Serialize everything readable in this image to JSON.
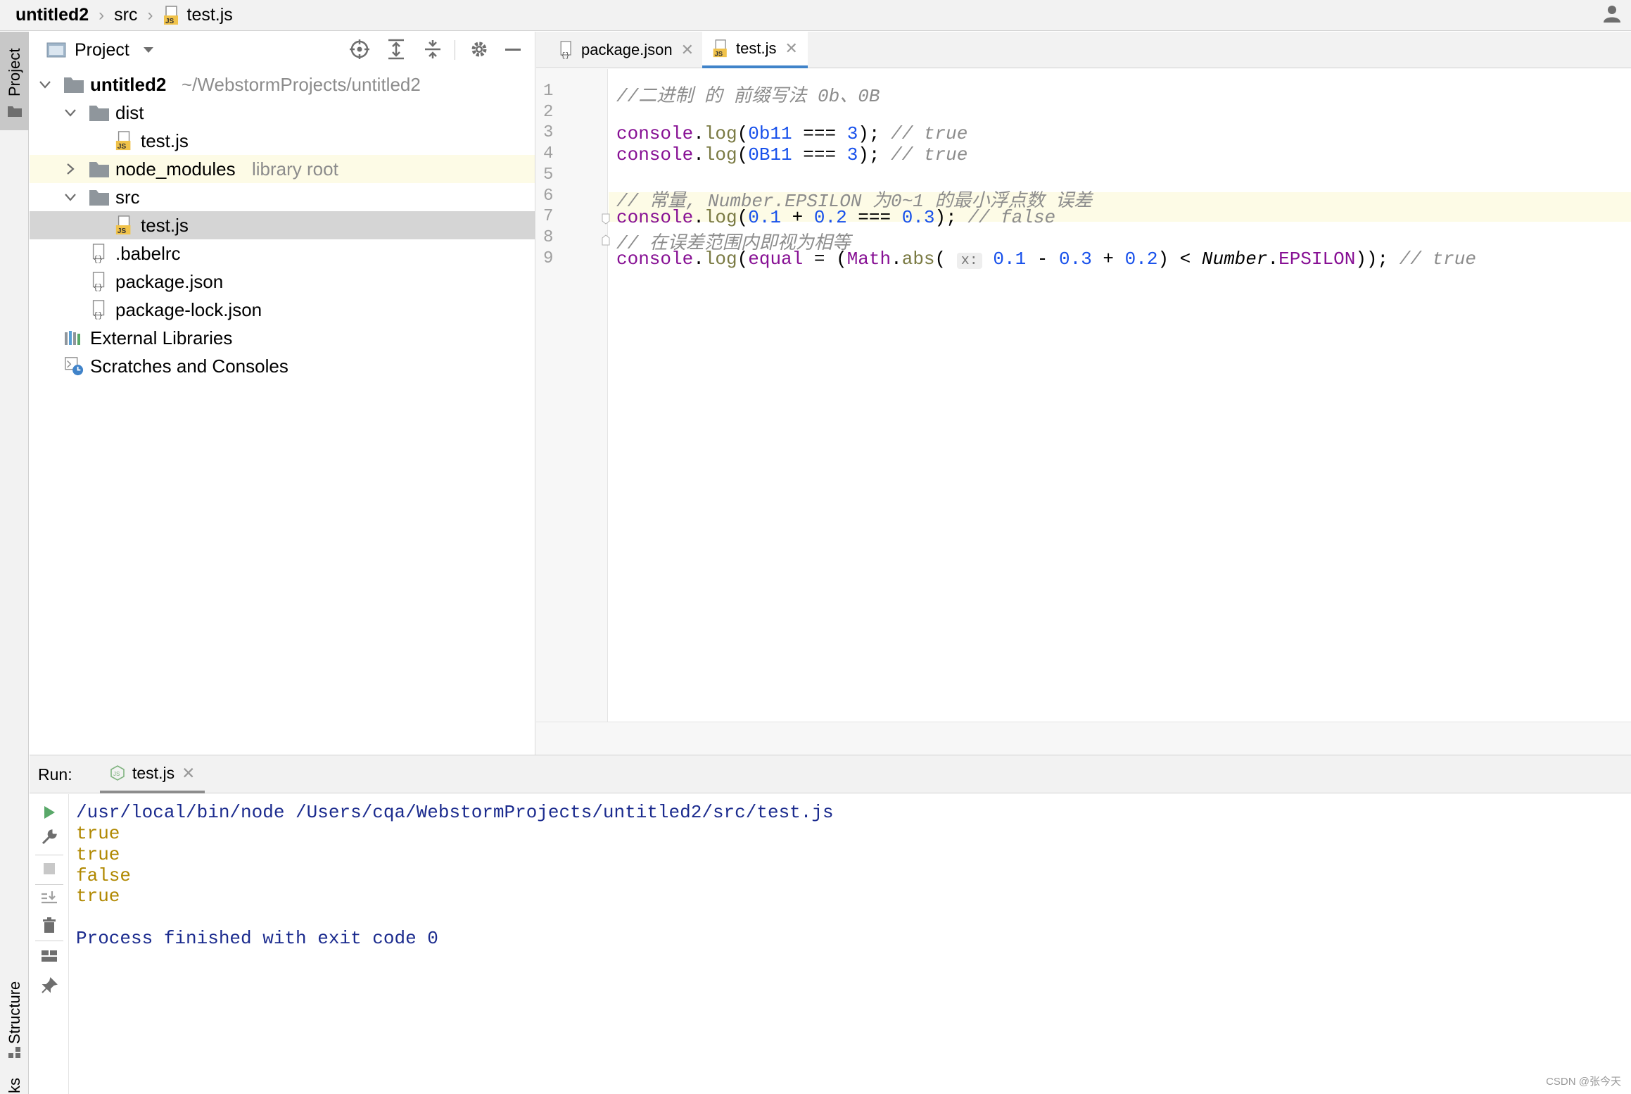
{
  "breadcrumb": {
    "items": [
      {
        "label": "untitled2"
      },
      {
        "label": "src"
      },
      {
        "label": "test.js"
      }
    ]
  },
  "left_strip": {
    "project_label": "Project",
    "structure_label": "Structure",
    "bookmarks_label": "ks"
  },
  "project_panel": {
    "title": "Project",
    "tree": [
      {
        "label": "untitled2",
        "path": "~/WebstormProjects/untitled2"
      },
      {
        "label": "dist"
      },
      {
        "label": "test.js"
      },
      {
        "label": "node_modules",
        "hint": "library root"
      },
      {
        "label": "src"
      },
      {
        "label": "test.js"
      },
      {
        "label": ".babelrc"
      },
      {
        "label": "package.json"
      },
      {
        "label": "package-lock.json"
      },
      {
        "label": "External Libraries"
      },
      {
        "label": "Scratches and Consoles"
      }
    ]
  },
  "editor": {
    "tabs": [
      {
        "label": "package.json"
      },
      {
        "label": "test.js"
      }
    ],
    "line_numbers": [
      "1",
      "2",
      "3",
      "4",
      "5",
      "6",
      "7",
      "8",
      "9"
    ],
    "hint_label": "x:",
    "code": {
      "l1": "//二进制 的 前缀写法 0b、0B",
      "l3_comment": "// true",
      "l4_comment": "// true",
      "l6": "// 常量, Number.EPSILON 为0~1 的最小浮点数 误差",
      "l7_comment": "// false",
      "l8": "// 在误差范围内即视为相等",
      "l9_comment": "// true"
    }
  },
  "run_panel": {
    "label": "Run:",
    "tab": "test.js",
    "output": [
      "/usr/local/bin/node /Users/cqa/WebstormProjects/untitled2/src/test.js",
      "true",
      "true",
      "false",
      "true",
      "Process finished with exit code 0"
    ]
  },
  "watermark": "CSDN @张今天",
  "colors": {
    "selected_row": "#d5d5d5",
    "library_root_row": "#fdfbe6",
    "active_tab_underline": "#4083c9",
    "method": "#871094",
    "number": "#1750eb",
    "output_result": "#b08800"
  }
}
